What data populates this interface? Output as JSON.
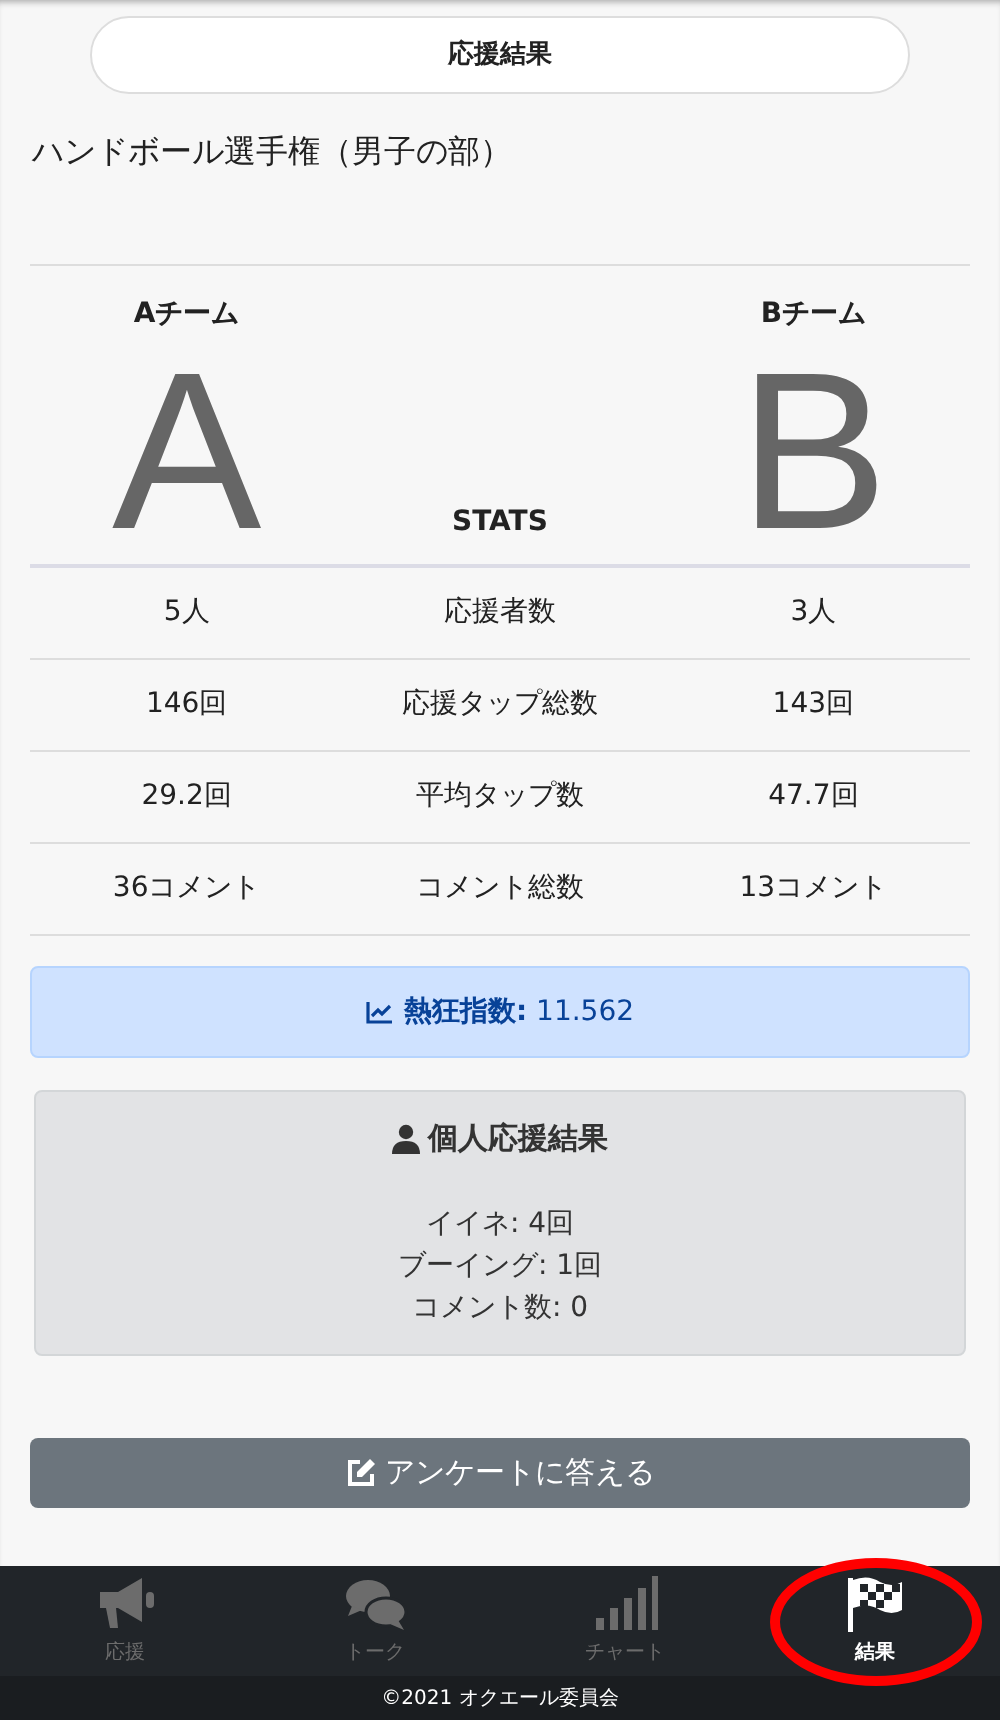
{
  "header": {
    "title": "応援結果"
  },
  "event": {
    "title": "ハンドボール選手権（男子の部）"
  },
  "teams": [
    {
      "name": "Aチーム",
      "letter": "A"
    },
    {
      "name": "Bチーム",
      "letter": "B"
    }
  ],
  "stats_label": "STATS",
  "stats": [
    {
      "a": "5人",
      "label": "応援者数",
      "b": "3人"
    },
    {
      "a": "146回",
      "label": "応援タップ総数",
      "b": "143回"
    },
    {
      "a": "29.2回",
      "label": "平均タップ数",
      "b": "47.7回"
    },
    {
      "a": "36コメント",
      "label": "コメント総数",
      "b": "13コメント"
    }
  ],
  "fever": {
    "label": "熱狂指数:",
    "value": "11.562"
  },
  "personal": {
    "title": "個人応援結果",
    "lines": [
      "イイネ: 4回",
      "ブーイング: 1回",
      "コメント数: 0"
    ]
  },
  "survey_button": {
    "label": "アンケートに答える"
  },
  "nav": [
    {
      "label": "応援",
      "kind": "megaphone",
      "selected": false,
      "highlighted": false
    },
    {
      "label": "トーク",
      "kind": "chat",
      "selected": false,
      "highlighted": false
    },
    {
      "label": "チャート",
      "kind": "signal",
      "selected": false,
      "highlighted": false
    },
    {
      "label": "結果",
      "kind": "flag",
      "selected": true,
      "highlighted": true
    }
  ],
  "footer": "©2021 オクエール委員会"
}
